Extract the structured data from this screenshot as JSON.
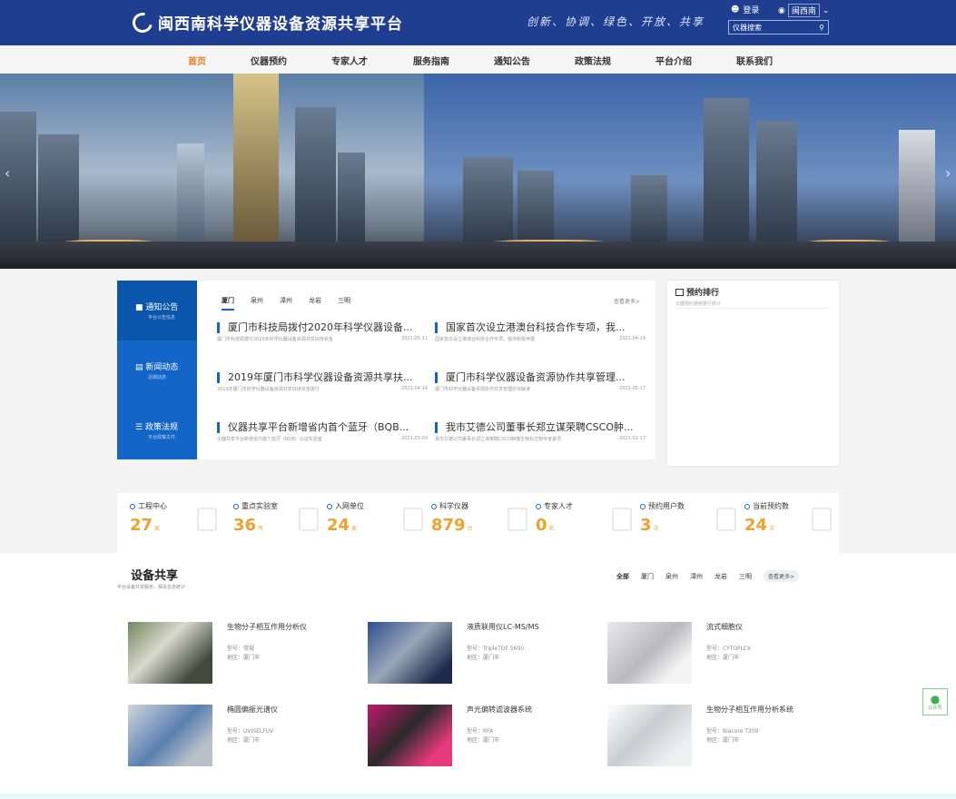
{
  "header": {
    "logo_text": "闽西南科学仪器设备资源共享平台",
    "slogan": "创新、协调、绿色、开放、共享",
    "login": "登录",
    "region": "闽西南",
    "search_placeholder": "仪器搜索"
  },
  "nav": [
    "首页",
    "仪器预约",
    "专家人才",
    "服务指南",
    "通知公告",
    "政策法规",
    "平台介绍",
    "联系我们"
  ],
  "side_tabs": [
    {
      "label": "通知公告",
      "sub": "平台公告信息"
    },
    {
      "label": "新闻动态",
      "sub": "近期动态"
    },
    {
      "label": "政策法规",
      "sub": "平台政策文件"
    }
  ],
  "city_tabs": [
    "厦门",
    "泉州",
    "漳州",
    "龙岩",
    "三明"
  ],
  "more": "查看更多>",
  "news": [
    {
      "title": "厦门市科技局拨付2020年科学仪器设备...",
      "desc": "厦门市科技局拨付2020年科学仪器设备资源共享扶持资金",
      "date": "2021-05-11"
    },
    {
      "title": "国家首次设立港澳台科技合作专项，我...",
      "desc": "国家首次设立港澳台科技合作专项，我市积极申报",
      "date": "2021-04-14"
    },
    {
      "title": "2019年厦门市科学仪器设备资源共享扶...",
      "desc": "2019年厦门市科学仪器设备资源共享扶持资金拨付",
      "date": "2021-04-14"
    },
    {
      "title": "厦门市科学仪器设备资源协作共享管理...",
      "desc": "厦门市科学仪器设备资源协作共享管理办法解读",
      "date": "2021-05-17"
    },
    {
      "title": "仪器共享平台新增省内首个蓝牙（BQB...",
      "desc": "仪器共享平台新增省内首个蓝牙（BQB）认证实验室",
      "date": "2021-03-09"
    },
    {
      "title": "我市艾德公司董事长郑立谋荣聘CSCO肿...",
      "desc": "我市艾德公司董事长郑立谋荣聘CSCO肿瘤生物标志物专家委员",
      "date": "2021-02-17"
    }
  ],
  "rank": {
    "title": "预约排行",
    "sub": "仪器预约使用排行统计"
  },
  "stats": [
    {
      "label": "工程中心",
      "value": "27",
      "unit": "家"
    },
    {
      "label": "重点实验室",
      "value": "36",
      "unit": "所"
    },
    {
      "label": "入网单位",
      "value": "24",
      "unit": "家"
    },
    {
      "label": "科学仪器",
      "value": "879",
      "unit": "台"
    },
    {
      "label": "专家人才",
      "value": "0",
      "unit": "名"
    },
    {
      "label": "预约用户数",
      "value": "3",
      "unit": "次"
    },
    {
      "label": "当前预约数",
      "value": "24",
      "unit": "次"
    }
  ],
  "equipment_section": {
    "title": "设备共享",
    "sub": "平台设备共享服务，相关信息统计",
    "tabs": [
      "全部",
      "厦门",
      "泉州",
      "漳州",
      "龙岩",
      "三明"
    ],
    "more": "查看更多>"
  },
  "equipment": [
    {
      "name": "生物分子相互作用分析仪",
      "model": "型号：常规",
      "area": "地区：厦门市"
    },
    {
      "name": "液质联用仪LC-MS/MS",
      "model": "型号：TripleTOF 5600",
      "area": "地区：厦门市"
    },
    {
      "name": "流式细胞仪",
      "model": "型号：CYTOFLEX",
      "area": "地区：厦门市"
    },
    {
      "name": "椭圆偏振光谱仪",
      "model": "型号：UVISELFUV",
      "area": "地区：厦门市"
    },
    {
      "name": "声光偏转滤波器系统",
      "model": "型号：RFA",
      "area": "地区：厦门市"
    },
    {
      "name": "生物分子相互作用分析系统",
      "model": "型号：Biacore T200",
      "area": "地区：厦门市"
    }
  ],
  "wechat_label": "公众号"
}
